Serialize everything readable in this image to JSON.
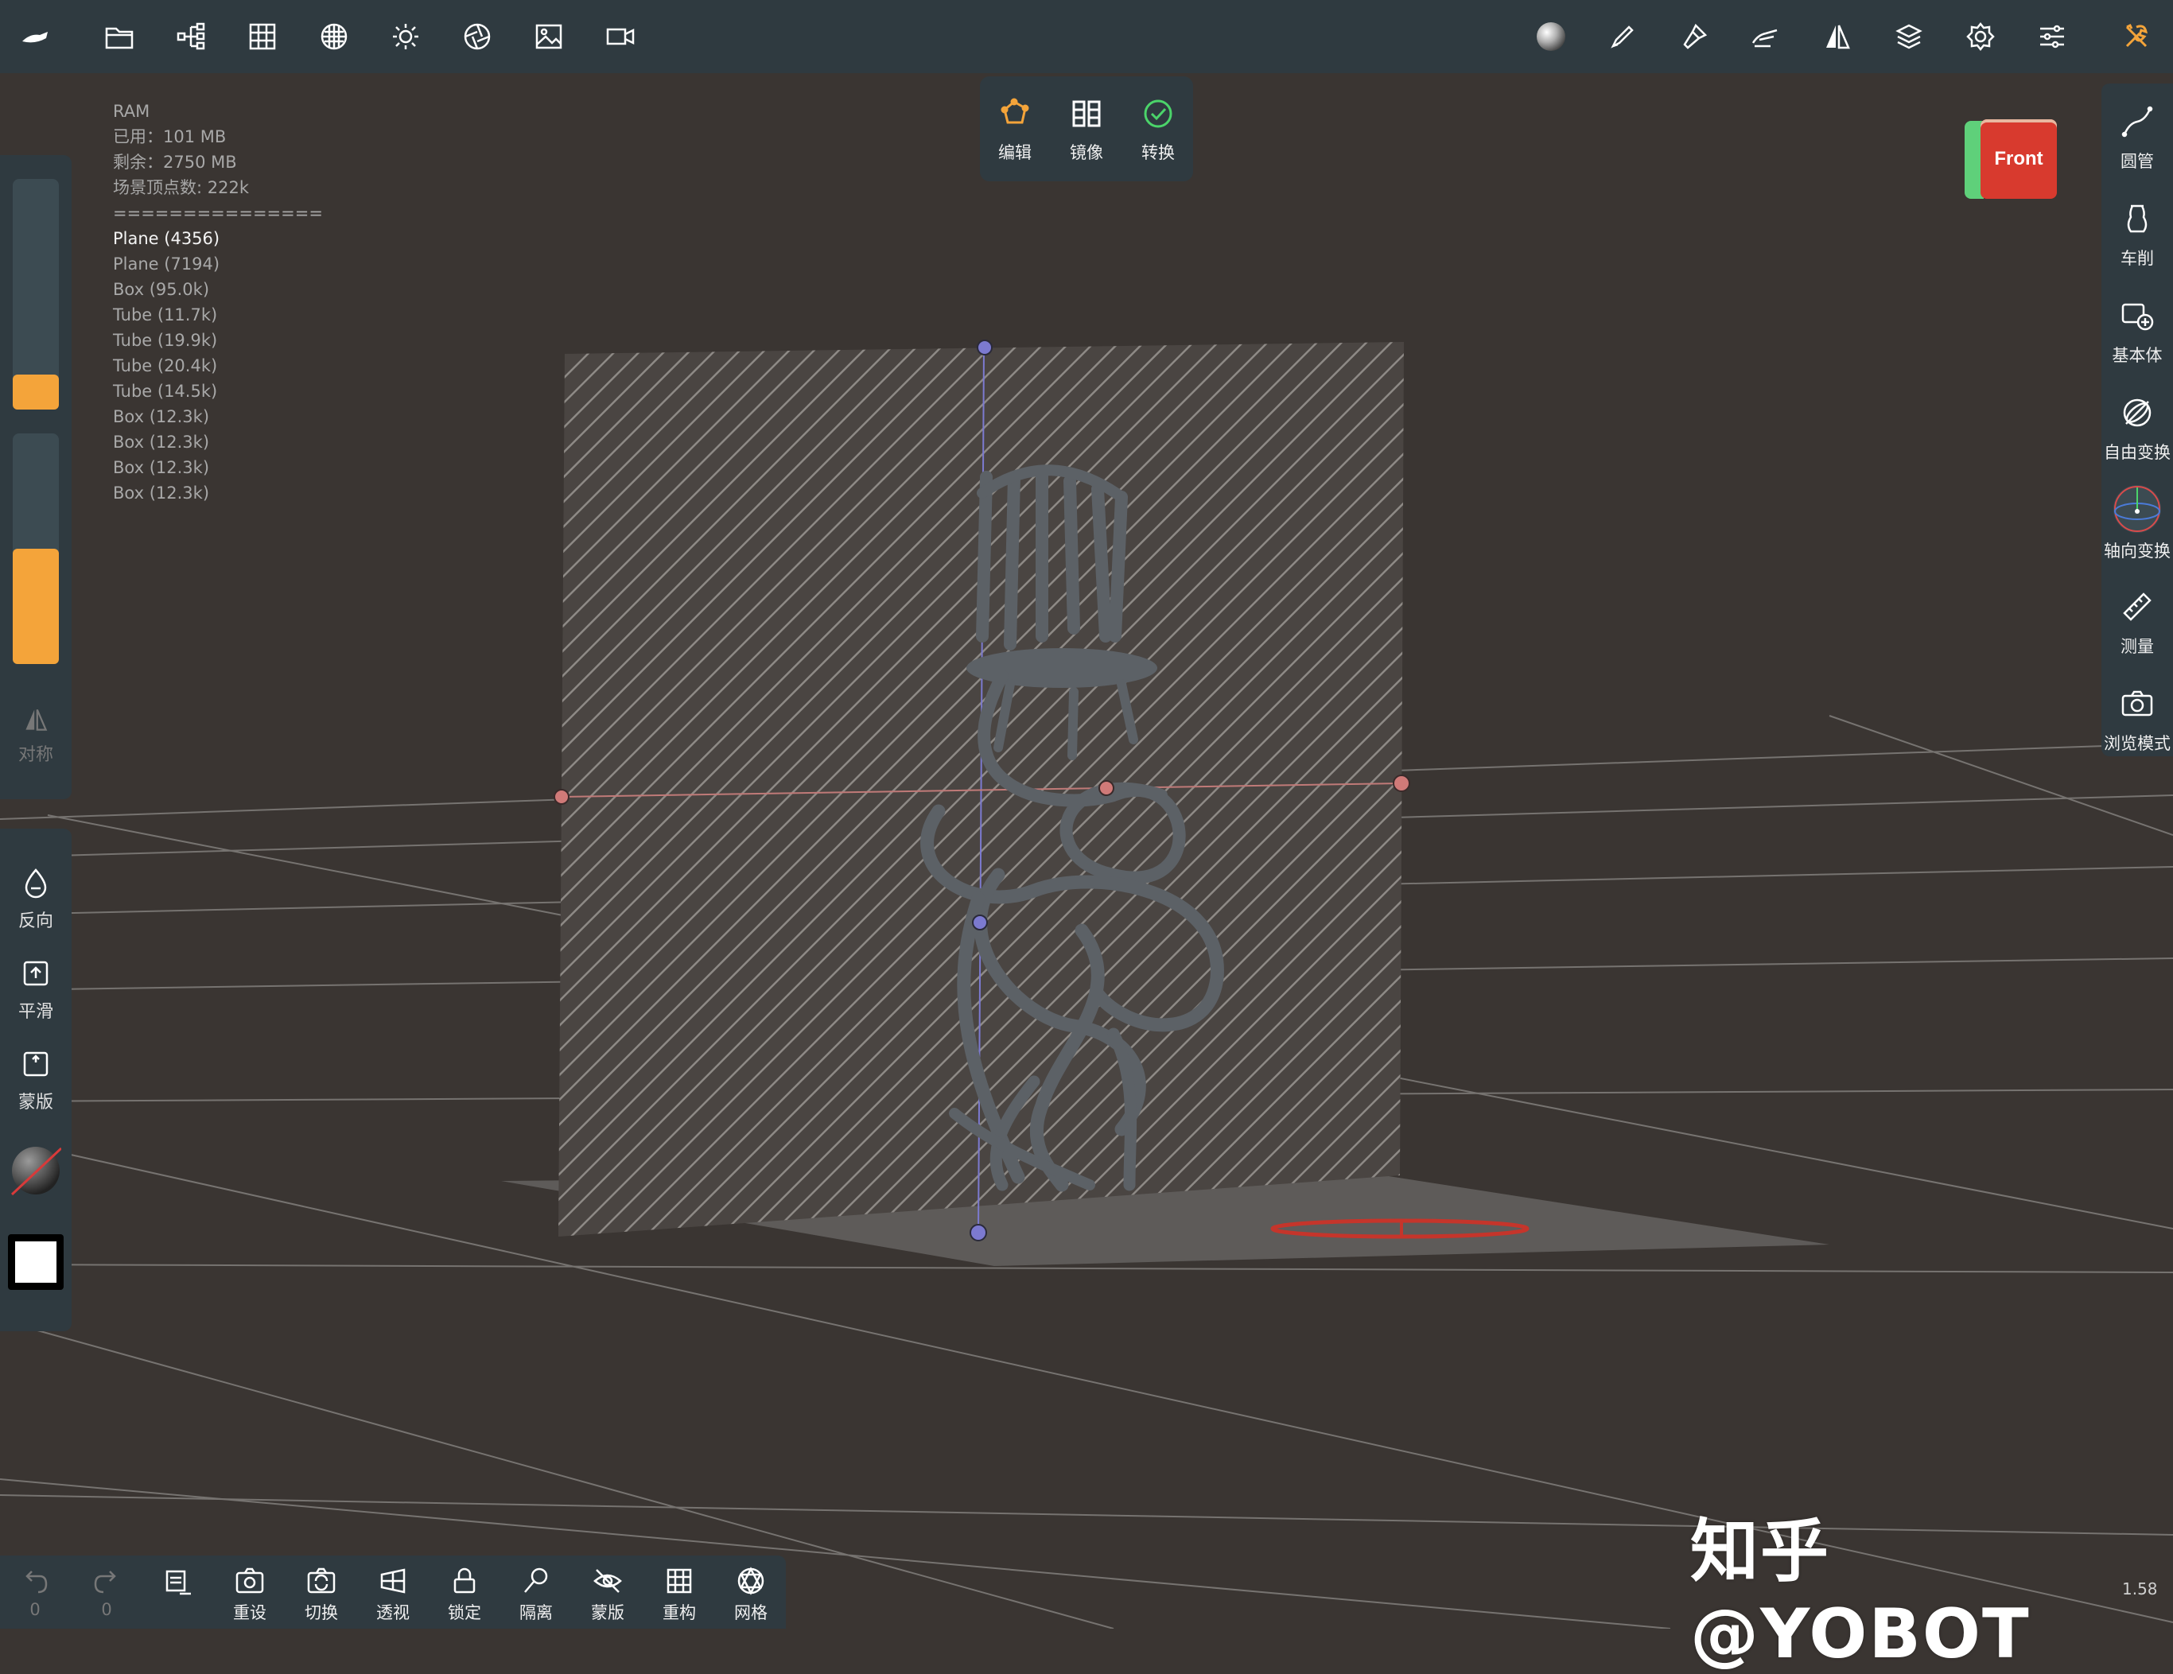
{
  "top_toolbar": {
    "icons": [
      "app-menu-icon",
      "folder-icon",
      "scene-tree-icon",
      "grid-icon",
      "texture-icon",
      "sun-icon",
      "aperture-icon",
      "image-icon",
      "video-icon",
      "material-sphere-icon",
      "brush-icon",
      "paint-icon",
      "hand-sculpt-icon",
      "symmetry-icon",
      "layers-icon",
      "settings-icon",
      "sliders-icon",
      "tools-icon"
    ]
  },
  "popup": {
    "items": [
      {
        "label": "编辑",
        "icon": "edit-curve-icon"
      },
      {
        "label": "镜像",
        "icon": "mirror-icon"
      },
      {
        "label": "转换",
        "icon": "convert-check-icon"
      }
    ]
  },
  "stats": {
    "lines": [
      "RAM",
      "已用：101 MB",
      "剩余：2750 MB",
      "场景顶点数: 222k",
      "==============="
    ],
    "objects": [
      "Plane (4356)",
      "Plane (7194)",
      "Box (95.0k)",
      "Tube (11.7k)",
      "Tube (19.9k)",
      "Tube (20.4k)",
      "Tube (14.5k)",
      "Box (12.3k)",
      "Box (12.3k)",
      "Box (12.3k)",
      "Box (12.3k)"
    ],
    "selected_index": 0
  },
  "left_panel": {
    "slider_radius_value": 0.15,
    "slider_intensity_value": 0.5,
    "symmetry_label": "对称",
    "tools": [
      {
        "label": "反向",
        "icon": "drop-invert-icon"
      },
      {
        "label": "平滑",
        "icon": "smooth-icon"
      },
      {
        "label": "蒙版",
        "icon": "mask-icon"
      }
    ]
  },
  "right_panel": {
    "items": [
      {
        "label": "圆管",
        "icon": "tube-curve-icon"
      },
      {
        "label": "车削",
        "icon": "lathe-icon"
      },
      {
        "label": "基本体",
        "icon": "add-primitive-icon"
      },
      {
        "label": "自由变换",
        "icon": "free-transform-icon"
      },
      {
        "label": "轴向变换",
        "icon": "axis-gizmo-icon"
      },
      {
        "label": "测量",
        "icon": "ruler-icon"
      },
      {
        "label": "浏览模式",
        "icon": "camera-icon"
      }
    ]
  },
  "view_cube": {
    "front_label": "Front"
  },
  "bottom_bar": {
    "undo_count": "0",
    "redo_count": "0",
    "items": [
      {
        "label": "重设",
        "icon": "reset-camera-icon"
      },
      {
        "label": "切换",
        "icon": "switch-camera-icon"
      },
      {
        "label": "透视",
        "icon": "perspective-icon"
      },
      {
        "label": "锁定",
        "icon": "lock-icon"
      },
      {
        "label": "隔离",
        "icon": "isolate-icon"
      },
      {
        "label": "蒙版",
        "icon": "mask-eye-icon"
      },
      {
        "label": "重构",
        "icon": "remesh-icon"
      },
      {
        "label": "网格",
        "icon": "mesh-icon"
      }
    ]
  },
  "watermark": "知乎 @YOBOT",
  "zoom_level": "1.58",
  "colors": {
    "panel": "#2f3a40",
    "accent": "#f4a43a",
    "background": "#3a3532"
  }
}
